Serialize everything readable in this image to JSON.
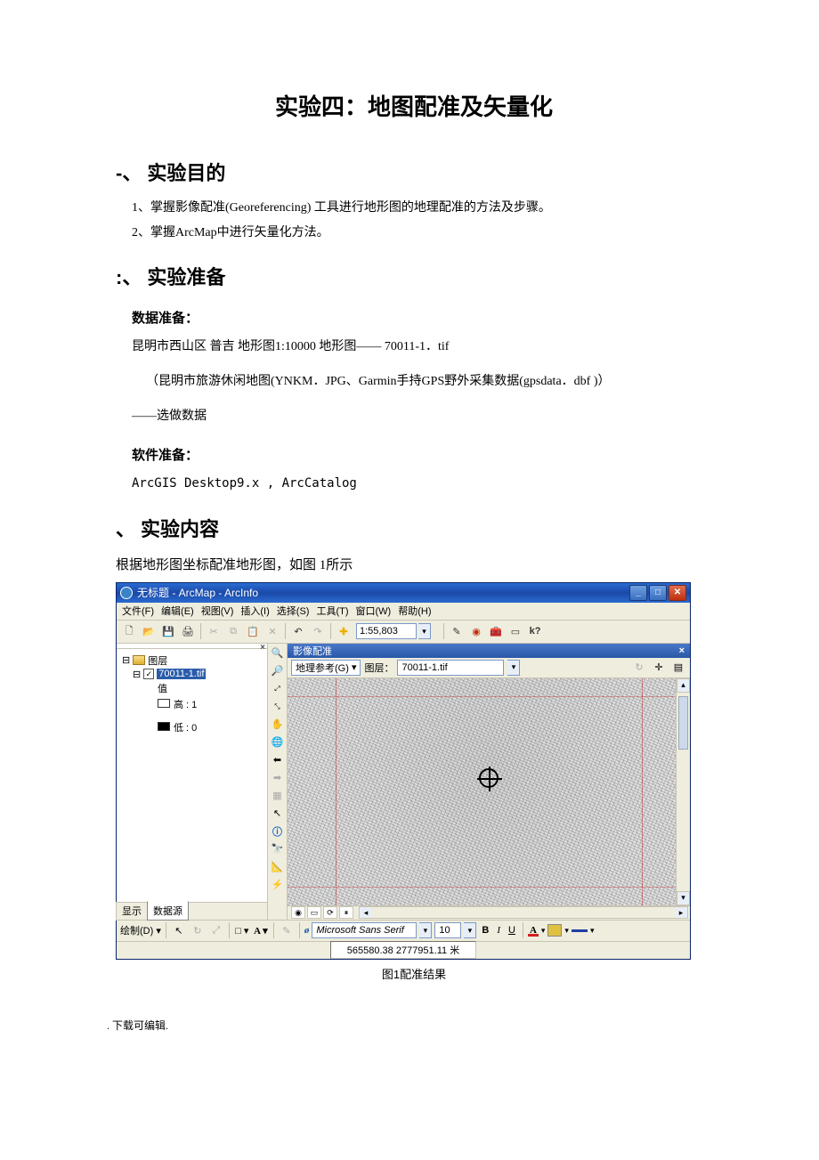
{
  "doc": {
    "title": "实验四：地图配准及矢量化",
    "sec1_title": "实验目的",
    "sec1_prefix": "-、",
    "sec1_item1": "1、掌握影像配准(Georeferencing) 工具进行地形图的地理配准的方法及步骤。",
    "sec1_item2": "2、掌握ArcMap中进行矢量化方法。",
    "sec2_title": "实验准备",
    "sec2_prefix": ":、",
    "sec2_datahdr": "数据准备：",
    "sec2_line1": "昆明市西山区 普吉 地形图1:10000 地形图—— 70011-1．tif",
    "sec2_line2": "（昆明市旅游休闲地图(YNKM．JPG、Garmin手持GPS野外采集数据(gpsdata．dbf )）",
    "sec2_line3": "——选做数据",
    "sec2_softhdr": "软件准备：",
    "sec2_soft": "ArcGIS Desktop9.x , ArcCatalog",
    "sec3_title": "实验内容",
    "sec3_prefix": "、",
    "sec3_line": "根据地形图坐标配准地形图，如图 1所示",
    "fig_caption": "图1配准结果",
    "footer": ". 下载可编辑."
  },
  "app": {
    "window_title": "无标题 - ArcMap - ArcInfo",
    "menu": {
      "file": "文件(F)",
      "edit": "编辑(E)",
      "view": "视图(V)",
      "insert": "插入(I)",
      "select": "选择(S)",
      "tools": "工具(T)",
      "window": "窗口(W)",
      "help": "帮助(H)"
    },
    "scale": "1:55,803",
    "toc": {
      "root": "图层",
      "layer": "70011-1.tif",
      "val_label": "值",
      "high": "高 : 1",
      "low": "低 : 0",
      "tab_display": "显示",
      "tab_source": "数据源"
    },
    "georef": {
      "bar_title": "影像配准",
      "geo_ref_btn": "地理参考(G)",
      "layer_label": "图层：",
      "layer_value": "70011-1.tif"
    },
    "drawing": {
      "label": "绘制(D)",
      "font": "Microsoft Sans Serif",
      "size": "10"
    },
    "status_coords": "565580.38 2777951.11 米"
  }
}
